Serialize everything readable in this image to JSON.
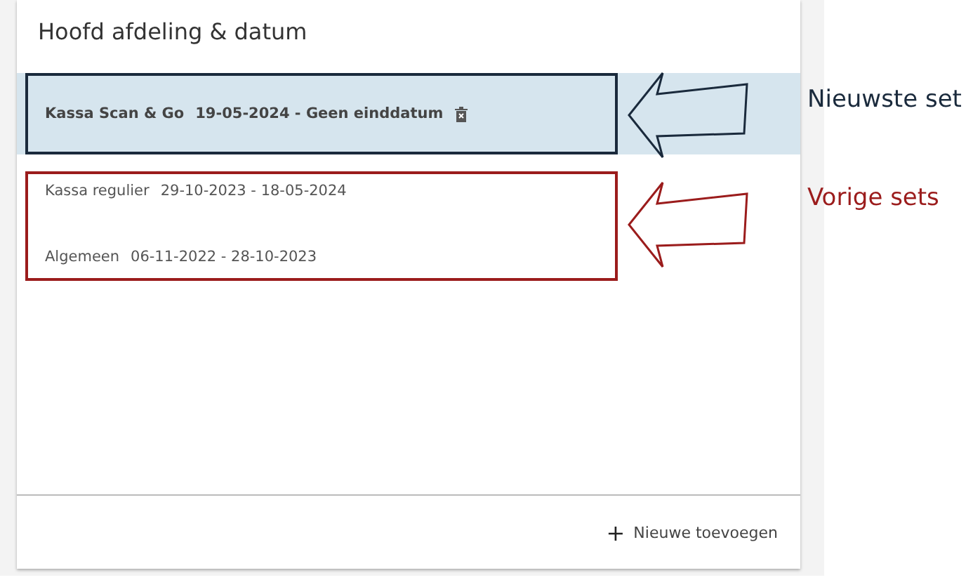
{
  "card": {
    "title": "Hoofd afdeling & datum",
    "items": [
      {
        "name": "Kassa Scan & Go",
        "dates": "19-05-2024 - Geen einddatum",
        "selected": true
      },
      {
        "name": "Kassa regulier",
        "dates": "29-10-2023 - 18-05-2024",
        "selected": false
      },
      {
        "name": "Algemeen",
        "dates": "06-11-2022 - 28-10-2023",
        "selected": false
      }
    ],
    "add_button": {
      "icon": "+",
      "label": "Nieuwe toevoegen"
    }
  },
  "annotations": [
    {
      "label": "Nieuwste set",
      "color": "#1a2a3c"
    },
    {
      "label": "Vorige sets",
      "color": "#9b1c1c"
    }
  ]
}
